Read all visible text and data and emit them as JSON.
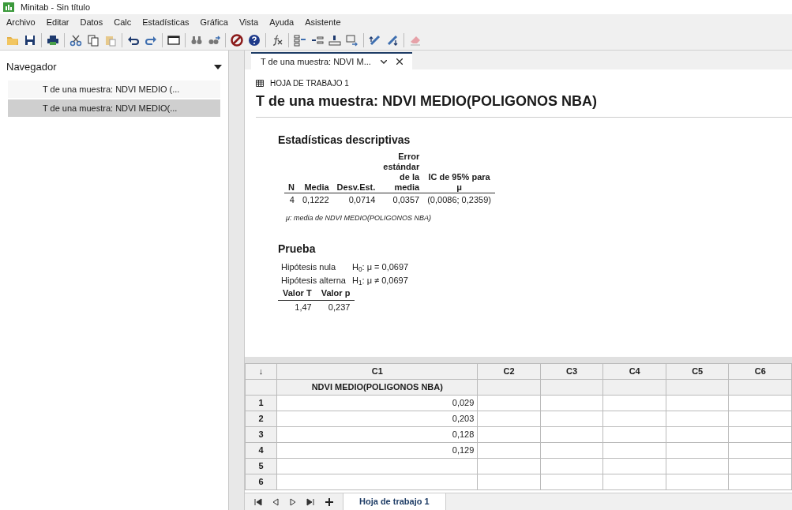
{
  "window": {
    "title": "Minitab - Sin título"
  },
  "menu": [
    "Archivo",
    "Editar",
    "Datos",
    "Calc",
    "Estadísticas",
    "Gráfica",
    "Vista",
    "Ayuda",
    "Asistente"
  ],
  "navigator": {
    "title": "Navegador",
    "items": [
      {
        "label": "T de una muestra: NDVI MEDIO (...",
        "selected": false
      },
      {
        "label": "T de una muestra: NDVI MEDIO(...",
        "selected": true
      }
    ]
  },
  "output_tab": {
    "label": "T de una muestra: NDVI M..."
  },
  "output": {
    "worksheet": "HOJA DE TRABAJO 1",
    "title": "T de una muestra: NDVI MEDIO(POLIGONOS NBA)",
    "descriptive": {
      "heading": "Estadísticas descriptivas",
      "columns": [
        "N",
        "Media",
        "Desv.Est.",
        "Error\nestándar\nde la\nmedia",
        "IC de 95% para\nμ"
      ],
      "rows": [
        [
          "4",
          "0,1222",
          "0,0714",
          "0,0357",
          "(0,0086; 0,2359)"
        ]
      ],
      "note": "μ: media de NDVI MEDIO(POLIGONOS NBA)"
    },
    "test": {
      "heading": "Prueba",
      "hypotheses": [
        {
          "label": "Hipótesis nula",
          "value": "H$_{0}$: μ = 0,0697"
        },
        {
          "label": "Hipótesis alterna",
          "value": "H$_{1}$: μ ≠ 0,0697"
        }
      ],
      "columns": [
        "Valor T",
        "Valor p"
      ],
      "rows": [
        [
          "1,47",
          "0,237"
        ]
      ]
    }
  },
  "worksheet": {
    "corner": "↓",
    "columns": [
      {
        "id": "C1",
        "name": "NDVI MEDIO(POLIGONOS NBA)"
      },
      {
        "id": "C2"
      },
      {
        "id": "C3"
      },
      {
        "id": "C4"
      },
      {
        "id": "C5"
      },
      {
        "id": "C6"
      }
    ],
    "rows": [
      {
        "n": "1",
        "cells": [
          "0,029"
        ]
      },
      {
        "n": "2",
        "cells": [
          "0,203"
        ]
      },
      {
        "n": "3",
        "cells": [
          "0,128"
        ]
      },
      {
        "n": "4",
        "cells": [
          "0,129"
        ]
      },
      {
        "n": "5",
        "cells": []
      },
      {
        "n": "6",
        "cells": []
      }
    ]
  },
  "sheet_tabs": [
    {
      "label": "Hoja de trabajo 1",
      "selected": true
    }
  ]
}
